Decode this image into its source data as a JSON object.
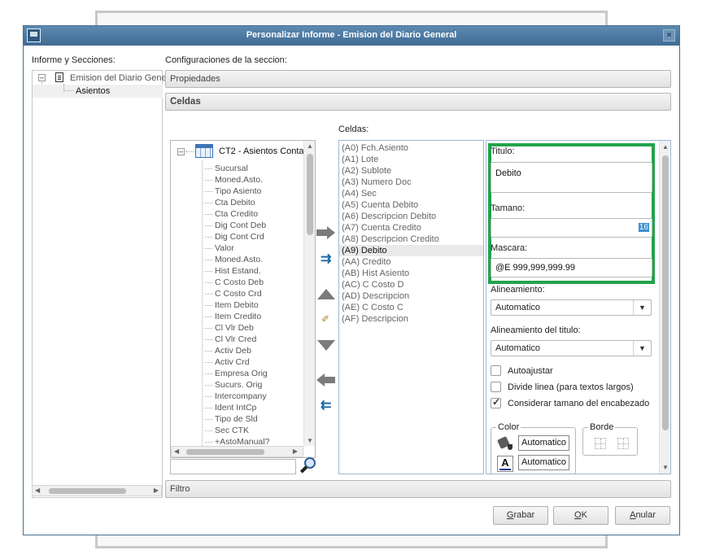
{
  "dialog": {
    "title": "Personalizar Informe - Emision del Diario General",
    "close_glyph": "×"
  },
  "left_panel": {
    "label": "Informe y Secciones:",
    "tree_root": "Emision del Diario Gene",
    "tree_child": "Asientos"
  },
  "config": {
    "label": "Configuraciones de la seccion:",
    "propiedades": "Propiedades",
    "celdas_header": "Celdas",
    "filtro": "Filtro"
  },
  "fields_tree": {
    "root": "CT2 - Asientos Conta",
    "items": [
      "Sucursal",
      "Moned.Asto.",
      "Tipo Asiento",
      "Cta Debito",
      "Cta Credito",
      "Dig Cont Deb",
      "Dig Cont Crd",
      "Valor",
      "Moned.Asto.",
      "Hist Estand.",
      "C Costo Deb",
      "C Costo Crd",
      "Item Debito",
      "Item Credito",
      "Cl Vlr Deb",
      "Cl Vlr Cred",
      "Activ Deb",
      "Activ Crd",
      "Empresa Orig",
      "Sucurs. Orig",
      "Intercompany",
      "Ident IntCp",
      "Tipo de Sld",
      "Sec CTK",
      "+AstoManual?"
    ],
    "search_value": ""
  },
  "cells": {
    "label": "Celdas:",
    "items": [
      "(A0) Fch.Asiento",
      "(A1) Lote",
      "(A2) Sublote",
      "(A3) Numero Doc",
      "(A4) Sec",
      "(A5) Cuenta Debito",
      "(A6) Descripcion Debito",
      "(A7) Cuenta Credito",
      "(A8) Descripcion Credito",
      "(A9) Debito",
      "(AA) Credito",
      "(AB) Hist Asiento",
      "(AC) C Costo D",
      "(AD) Descripcion",
      "(AE) C Costo C",
      "(AF) Descripcion"
    ],
    "selected_index": 9
  },
  "properties": {
    "titulo_label": "Titulo:",
    "titulo_value": "Debito",
    "tamano_label": "Tamano:",
    "tamano_value": "16",
    "mascara_label": "Mascara:",
    "mascara_value": "@E 999,999,999.99",
    "alineamiento_label": "Alineamiento:",
    "alineamiento_value": "Automatico",
    "alineamiento_titulo_label": "Alineamiento del titulo:",
    "alineamiento_titulo_value": "Automatico",
    "autoajustar": {
      "label": "Autoajustar",
      "checked": false
    },
    "divide_linea": {
      "label": "Divide linea (para textos largos)",
      "checked": false
    },
    "considerar_tamano": {
      "label": "Considerar tamano del encabezado",
      "checked": true
    },
    "color_group": "Color",
    "color_fill_value": "Automatico",
    "color_font_value": "Automatico",
    "font_icon_letter": "A",
    "borde_group": "Borde",
    "highlight_color": "#23a34a"
  },
  "buttons": {
    "grabar_u": "G",
    "grabar_rest": "rabar",
    "ok_u": "O",
    "ok_rest": "K",
    "anular_u": "A",
    "anular_rest": "nular"
  },
  "colors": {
    "titlebar": "#4a7aa5",
    "selection": "#3d8fd1"
  }
}
